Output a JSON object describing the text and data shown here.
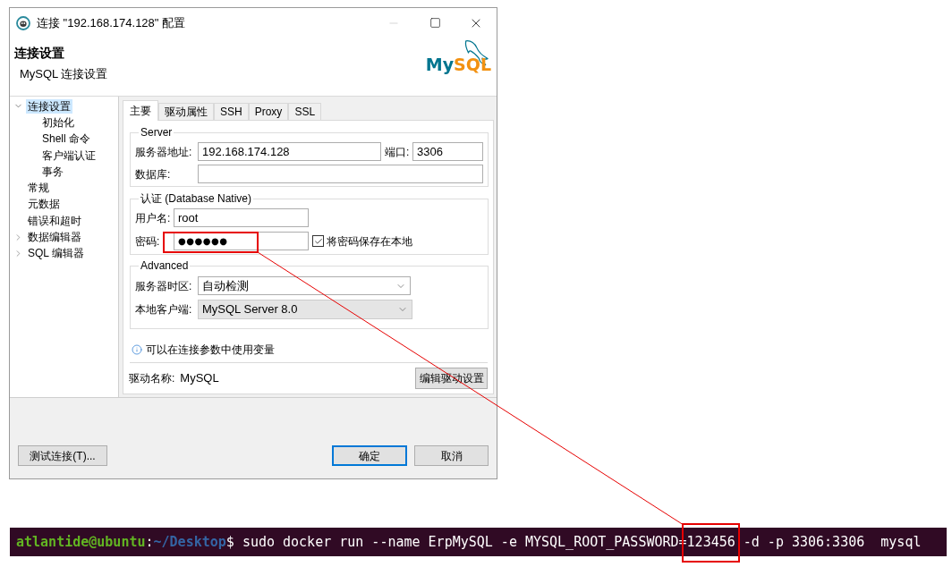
{
  "window": {
    "title": "连接 \"192.168.174.128\" 配置",
    "controls": [
      {
        "kind": "minimize",
        "disabled": true
      },
      {
        "kind": "maximize",
        "disabled": false
      },
      {
        "kind": "close",
        "disabled": false
      }
    ]
  },
  "header": {
    "title": "连接设置",
    "subtitle": "MySQL 连接设置",
    "logo": [
      {
        "text": "My",
        "color": "#00758f"
      },
      {
        "text": "SQL",
        "color": "#f29111"
      }
    ]
  },
  "sidebar": {
    "items": [
      {
        "label": "连接设置",
        "selected": true,
        "expanded": true,
        "children": [
          {
            "label": "初始化",
            "selected": false
          },
          {
            "label": "Shell 命令",
            "selected": false
          },
          {
            "label": "客户端认证",
            "selected": false
          },
          {
            "label": "事务",
            "selected": false
          }
        ]
      },
      {
        "label": "常规",
        "selected": false
      },
      {
        "label": "元数据",
        "selected": false
      },
      {
        "label": "错误和超时",
        "selected": false
      },
      {
        "label": "数据编辑器",
        "selected": false,
        "expanded": false
      },
      {
        "label": "SQL 编辑器",
        "selected": false,
        "expanded": false
      }
    ]
  },
  "tabs": [
    {
      "label": "主要",
      "selected": true
    },
    {
      "label": "驱动属性",
      "selected": false
    },
    {
      "label": "SSH",
      "selected": false
    },
    {
      "label": "Proxy",
      "selected": false
    },
    {
      "label": "SSL",
      "selected": false
    }
  ],
  "server": {
    "legend": "Server",
    "host": {
      "label": "服务器地址:",
      "value": "192.168.174.128"
    },
    "port": {
      "label": "端口:",
      "value": "3306"
    },
    "database": {
      "label": "数据库:"
    }
  },
  "auth": {
    "legend": "认证 (Database Native)",
    "username": {
      "label": "用户名:",
      "value": "root"
    },
    "password": {
      "label": "密码:",
      "value": "●●●●●●"
    },
    "save_password": {
      "label": "将密码保存在本地",
      "checked": true
    }
  },
  "advanced": {
    "legend": "Advanced",
    "timezone": {
      "label": "服务器时区:",
      "value": "自动检测",
      "disabled": false
    },
    "client": {
      "label": "本地客户端:",
      "value": "MySQL Server 8.0",
      "disabled": true
    }
  },
  "info": "可以在连接参数中使用变量",
  "driver": {
    "label": "驱动名称:",
    "value": "MySQL",
    "button": "编辑驱动设置"
  },
  "footer": {
    "buttons": [
      {
        "label": "测试连接(T)...",
        "kind": "test",
        "focused": false
      },
      {
        "label": "确定",
        "kind": "ok",
        "focused": true
      },
      {
        "label": "取消",
        "kind": "cancel",
        "focused": false
      }
    ]
  },
  "terminal": {
    "user_host": "atlantide@ubuntu",
    "separator": ":",
    "path": "~/Desktop",
    "prompt_symbol": "$",
    "command": "sudo docker run --name ErpMySQL -e MYSQL_ROOT_PASSWORD=123456 -d -p 3306:3306  mysql"
  }
}
